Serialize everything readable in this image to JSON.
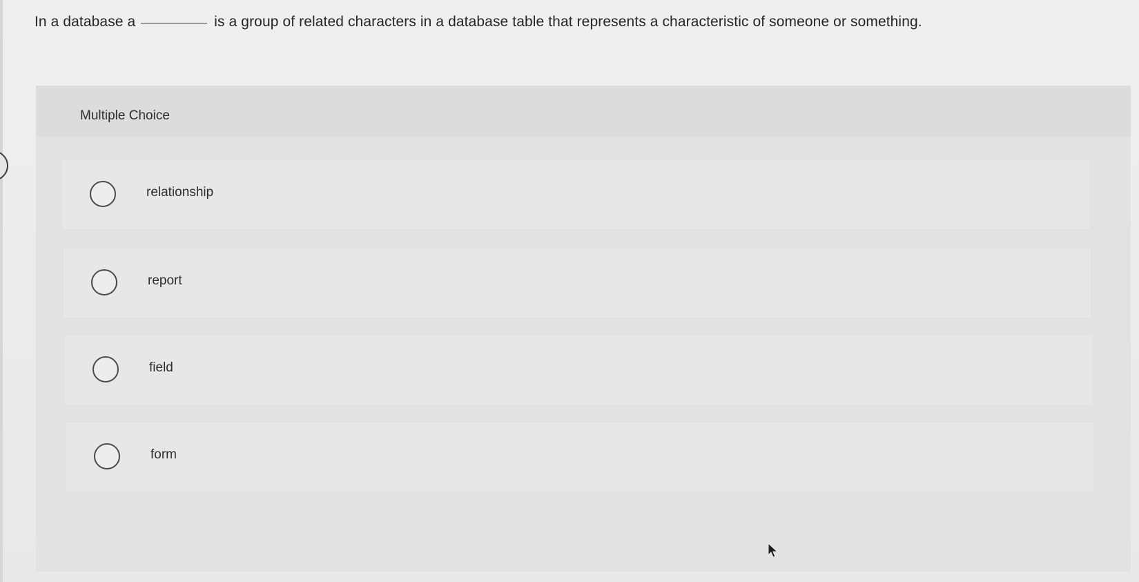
{
  "question": {
    "text_before": "In a database a",
    "text_after": "is a  group of related characters in a database table that represents a characteristic of someone or something."
  },
  "multiple_choice": {
    "title": "Multiple Choice",
    "options": [
      {
        "label": "relationship"
      },
      {
        "label": "report"
      },
      {
        "label": "field"
      },
      {
        "label": "form"
      }
    ]
  },
  "icons": {
    "radio": "radio-circle-icon",
    "cursor": "mouse-pointer-icon"
  }
}
